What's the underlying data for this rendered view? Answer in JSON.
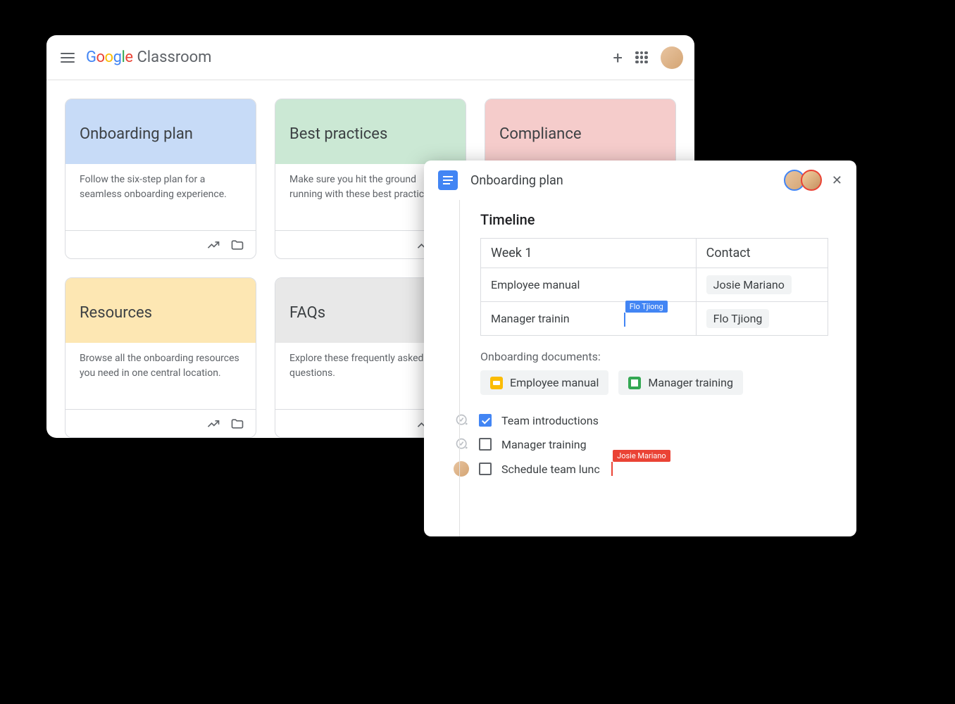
{
  "classroom": {
    "app_name": "Classroom",
    "google": {
      "g1": "G",
      "o1": "o",
      "o2": "o",
      "g2": "g",
      "l": "l",
      "e": "e"
    },
    "cards": [
      {
        "title": "Onboarding plan",
        "desc": "Follow the six-step plan for a seamless onboarding experience.",
        "color": "hdr-blue"
      },
      {
        "title": "Best practices",
        "desc": "Make sure you hit the ground running with these best practices.",
        "color": "hdr-green"
      },
      {
        "title": "Compliance",
        "desc": "",
        "color": "hdr-red"
      },
      {
        "title": "Resources",
        "desc": "Browse all the onboarding resources you need in one central location.",
        "color": "hdr-yellow"
      },
      {
        "title": "FAQs",
        "desc": "Explore these frequently asked questions.",
        "color": "hdr-gray"
      }
    ]
  },
  "docs": {
    "title": "Onboarding plan",
    "timeline_heading": "Timeline",
    "table": {
      "row1": {
        "a": "Week 1",
        "b": "Contact"
      },
      "row2": {
        "a": "Employee manual",
        "b": "Josie Mariano"
      },
      "row3": {
        "a": "Manager trainin",
        "b": "Flo Tjiong"
      }
    },
    "cursor_blue": "Flo Tjiong",
    "section_label": "Onboarding documents:",
    "chips": [
      {
        "label": "Employee manual",
        "icon": "slides"
      },
      {
        "label": "Manager training",
        "icon": "sheets"
      }
    ],
    "checklist": [
      {
        "text": "Team introductions",
        "checked": true,
        "left": "check-add"
      },
      {
        "text": "Manager training",
        "checked": false,
        "left": "check-add"
      },
      {
        "text": "Schedule team lunc",
        "checked": false,
        "left": "avatar"
      }
    ],
    "cursor_red": "Josie Mariano"
  }
}
